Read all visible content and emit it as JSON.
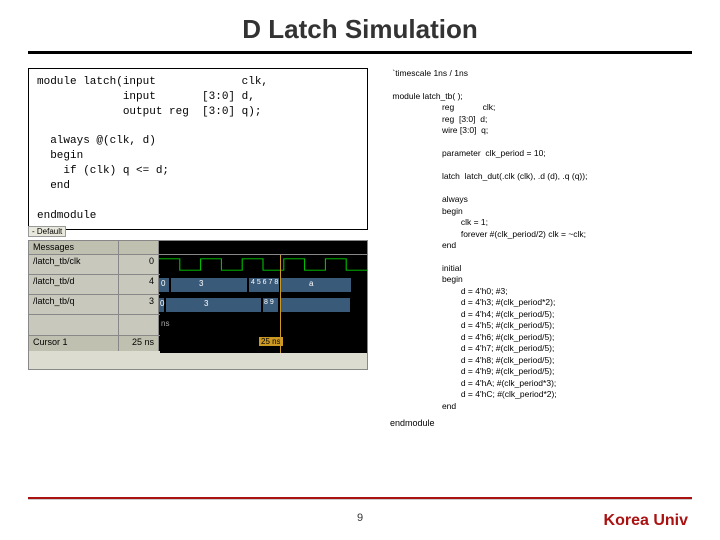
{
  "title": "D Latch Simulation",
  "module_code": "module latch(input             clk,\n             input       [3:0] d,\n             output reg  [3:0] q);\n\n  always @(clk, d)\n  begin\n    if (clk) q <= d;\n  end\n\nendmodule",
  "tb_code": " `timescale 1ns / 1ns\n\n module latch_tb( );\n                      reg            clk;\n                      reg  [3:0]  d;\n                      wire [3:0]  q;\n\n                      parameter  clk_period = 10;\n\n                      latch  latch_dut(.clk (clk), .d (d), .q (q));\n\n                      always\n                      begin\n                              clk = 1;\n                              forever #(clk_period/2) clk = ~clk;\n                      end\n\n                      initial\n                      begin\n                              d = 4'h0; #3;\n                              d = 4'h3; #(clk_period*2);\n                              d = 4'h4; #(clk_period/5);\n                              d = 4'h5; #(clk_period/5);\n                              d = 4'h6; #(clk_period/5);\n                              d = 4'h7; #(clk_period/5);\n                              d = 4'h8; #(clk_period/5);\n                              d = 4'h9; #(clk_period/5);\n                              d = 4'hA; #(clk_period*3);\n                              d = 4'hC; #(clk_period*2);\n                      end",
  "endmodule": "endmodule",
  "wave": {
    "default": "- Default",
    "messages": "Messages",
    "rows": [
      {
        "name": "/latch_tb/clk",
        "val": "0"
      },
      {
        "name": "/latch_tb/d",
        "val": "4"
      },
      {
        "name": "/latch_tb/q",
        "val": "3"
      }
    ],
    "cursor_label": "Cursor 1",
    "cursor_time": "25 ns",
    "tick1": "ns",
    "tick2": "25 ns",
    "d_vals": [
      "0",
      "3",
      "4 5 6 7 8",
      "a"
    ],
    "q_vals": [
      "0",
      "3",
      "8 9",
      ""
    ]
  },
  "page_num": "9",
  "univ": "Korea Univ"
}
